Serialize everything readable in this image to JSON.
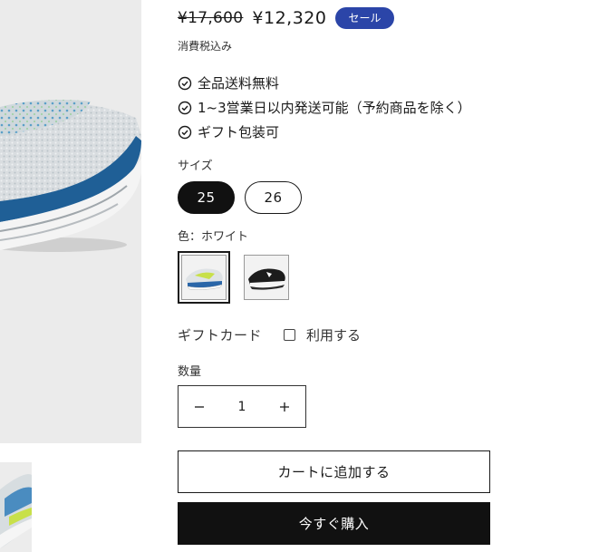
{
  "pricing": {
    "original_price": "¥17,600",
    "sale_price": "¥12,320",
    "sale_badge": "セール",
    "tax_note": "消費税込み"
  },
  "features": [
    {
      "label": "全品送料無料",
      "icon": "check-circle-icon"
    },
    {
      "label": "1~3営業日以内発送可能（予約商品を除く）",
      "icon": "check-circle-icon"
    },
    {
      "label": "ギフト包装可",
      "icon": "check-circle-icon"
    }
  ],
  "size": {
    "label": "サイズ",
    "options": [
      {
        "label": "25",
        "selected": true
      },
      {
        "label": "26",
        "selected": false
      }
    ]
  },
  "color": {
    "label": "色：ホワイト",
    "options": [
      {
        "name": "white-shoe-swatch",
        "selected": true
      },
      {
        "name": "black-shoe-swatch",
        "selected": false
      }
    ]
  },
  "gift_card": {
    "label": "ギフトカード",
    "checkbox_label": "利用する",
    "checked": false
  },
  "quantity": {
    "label": "数量",
    "value": "1",
    "decrement_icon": "minus-icon",
    "increment_icon": "plus-icon"
  },
  "actions": {
    "add_to_cart": "カートに追加する",
    "buy_now": "今すぐ購入"
  },
  "colors": {
    "sale_badge_bg": "#2b45a8",
    "primary_button_bg": "#111111",
    "shoe_accent_blue": "#1f5f96"
  }
}
